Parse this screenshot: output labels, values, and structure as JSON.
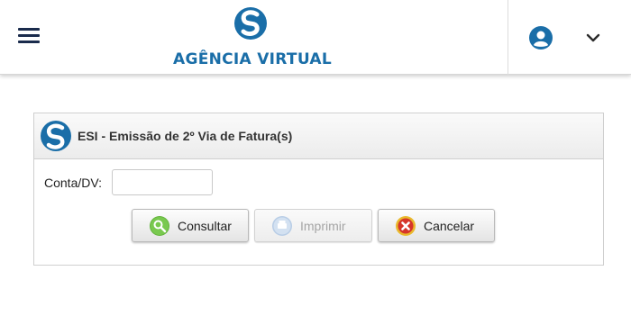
{
  "header": {
    "brand_name": "AGÊNCIA VIRTUAL",
    "icons": {
      "menu": "menu-icon",
      "logo": "agency-logo-icon",
      "user": "user-circle-icon",
      "chevron": "chevron-down-icon"
    }
  },
  "form": {
    "title": "ESI - Emissão de 2º Via de Fatura(s)",
    "account_label": "Conta/DV:",
    "account_value": "",
    "buttons": {
      "consultar": "Consultar",
      "imprimir": "Imprimir",
      "cancelar": "Cancelar"
    }
  },
  "colors": {
    "brand": "#1a6ea8",
    "text": "#222222",
    "disabled_text": "#a5a5a5"
  }
}
